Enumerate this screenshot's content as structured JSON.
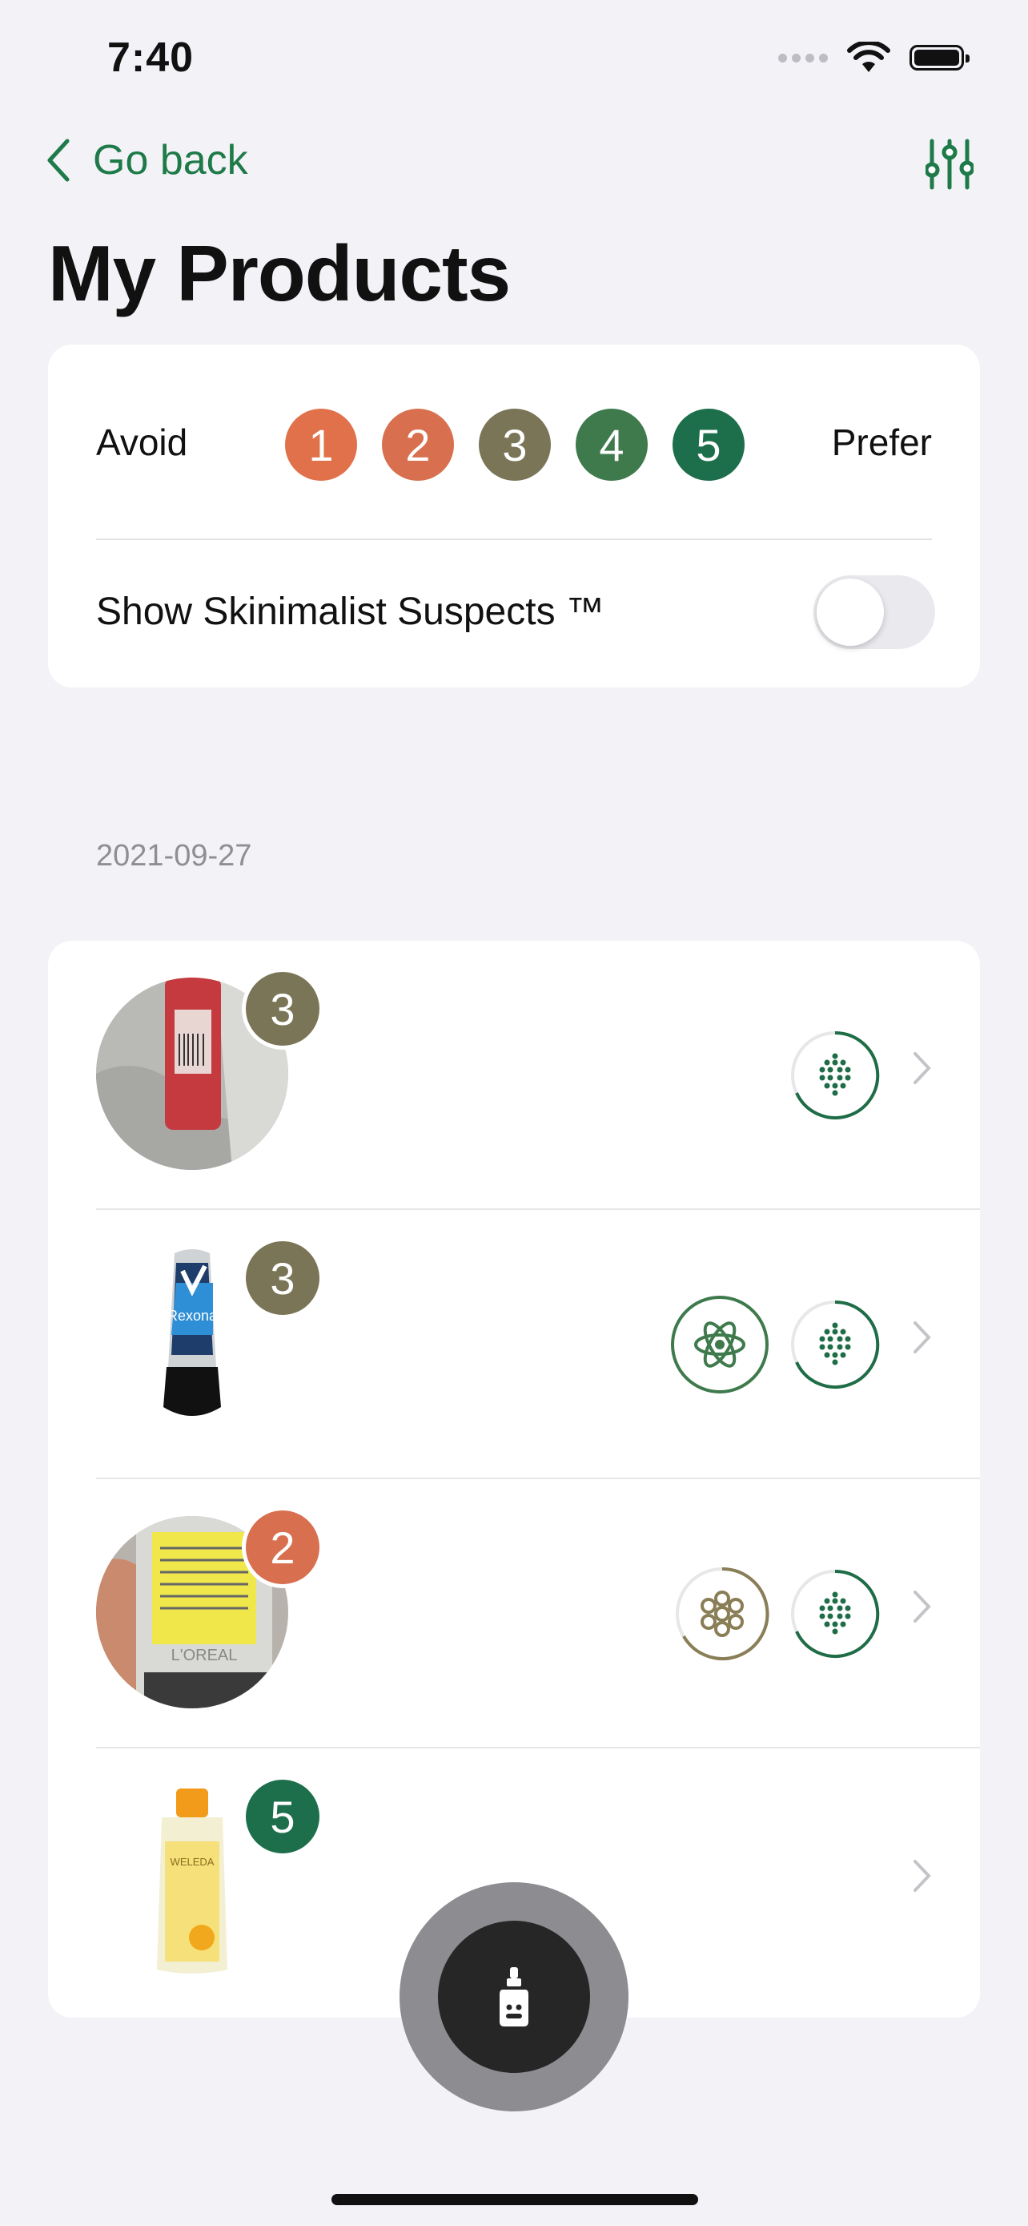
{
  "status_bar": {
    "time": "7:40",
    "icons": [
      "signal-dots-icon",
      "wifi-icon",
      "battery-icon"
    ]
  },
  "nav": {
    "back_label": "Go back",
    "filter_icon": "sliders-icon"
  },
  "page_title": "My Products",
  "filter_card": {
    "avoid_label": "Avoid",
    "prefer_label": "Prefer",
    "ratings": [
      {
        "label": "1",
        "color": "#e0714a"
      },
      {
        "label": "2",
        "color": "#d8704f"
      },
      {
        "label": "3",
        "color": "#7a7556"
      },
      {
        "label": "4",
        "color": "#3f7a4d"
      },
      {
        "label": "5",
        "color": "#1d6e4b"
      }
    ],
    "suspects_label": "Show Skinimalist Suspects ™",
    "suspects_toggle_on": false
  },
  "section_date": "2021-09-27",
  "products": [
    {
      "score": "3",
      "score_color": "#7a7556",
      "image": "red-bottle-photo",
      "indicators": [
        "particles-ring-icon"
      ]
    },
    {
      "score": "3",
      "score_color": "#7a7556",
      "image": "rexona-rollon-photo",
      "image_text": "Rexona",
      "indicators": [
        "atom-icon",
        "particles-ring-icon"
      ]
    },
    {
      "score": "2",
      "score_color": "#d8704f",
      "image": "loreal-bottle-photo",
      "image_text": "L'OREAL",
      "indicators": [
        "flower-ring-icon",
        "particles-ring-icon"
      ]
    },
    {
      "score": "5",
      "score_color": "#1d6e4b",
      "image": "weleda-lotion-photo",
      "image_text": "WELEDA",
      "indicators": []
    }
  ],
  "scan_button_icon": "dropper-bottle-icon"
}
